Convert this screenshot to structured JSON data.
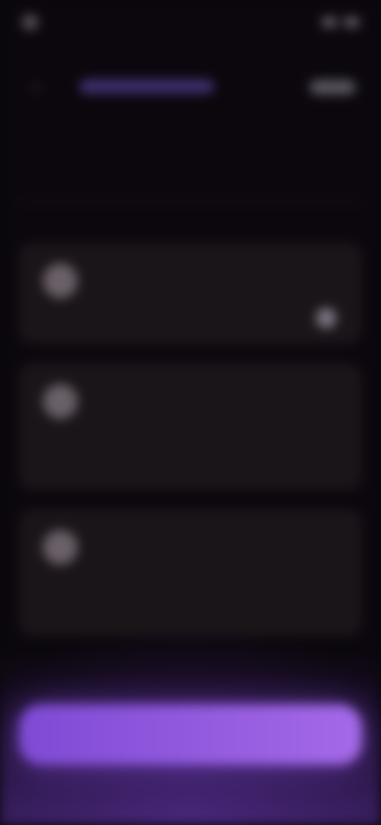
{
  "status": {
    "time": "",
    "indicators": [
      "signal-icon",
      "battery-icon"
    ]
  },
  "header": {
    "back_icon": "chevron-left-icon",
    "pill_label": "",
    "action_label": ""
  },
  "page": {
    "title": ""
  },
  "cards": [
    {
      "title": "",
      "link": "",
      "description": ""
    },
    {
      "title": "",
      "link": "",
      "description": ""
    },
    {
      "title": "",
      "link": "",
      "description": ""
    }
  ],
  "footer": {
    "button_label": ""
  },
  "colors": {
    "background": "#0b070d",
    "card": "#1a1519",
    "accent": "#8f54eb",
    "text": "#ece8ef"
  }
}
